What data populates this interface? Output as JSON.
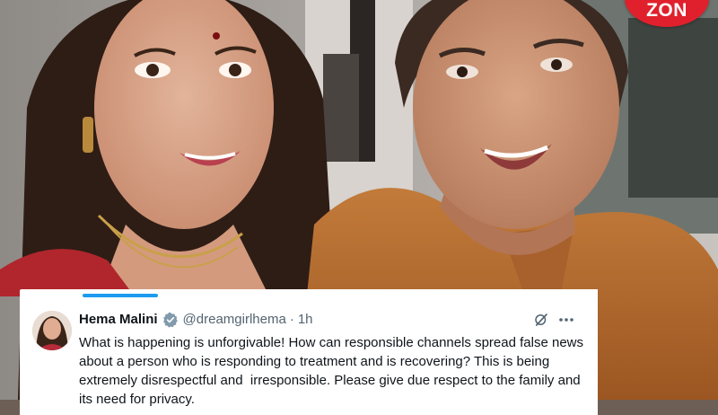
{
  "badge": {
    "text": "ZON"
  },
  "tweet": {
    "author_name": "Hema Malini",
    "handle": "@dreamgirlhema",
    "separator": "·",
    "time": "1h",
    "text": "What is happening is unforgivable! How can responsible channels spread false news about a person who is responding to treatment and is recovering? This is being extremely disrespectful and  irresponsible. Please give due respect to the family and its need for privacy."
  },
  "icons": {
    "verified": "verified-badge-icon",
    "grok": "grok-icon",
    "more": "more-options-icon"
  },
  "colors": {
    "brand_red": "#e0202c",
    "accent_blue": "#1d9bf0",
    "text_primary": "#0f1419",
    "text_secondary": "#536471"
  }
}
